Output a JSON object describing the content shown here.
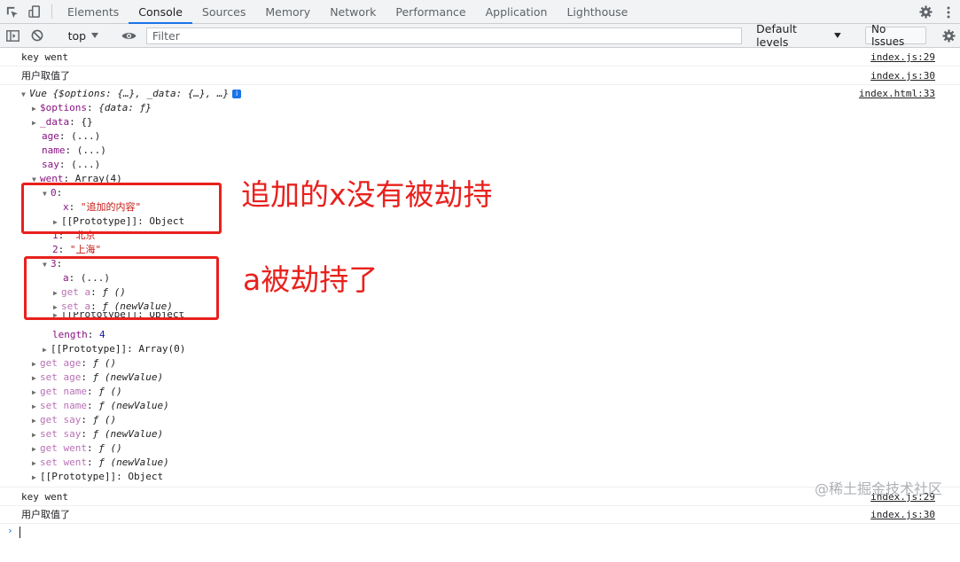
{
  "tabs": [
    "Elements",
    "Console",
    "Sources",
    "Memory",
    "Network",
    "Performance",
    "Application",
    "Lighthouse"
  ],
  "active_tab": "Console",
  "toolbar": {
    "context": "top",
    "filter_placeholder": "Filter",
    "levels": "Default levels",
    "issues": "No Issues"
  },
  "messages": [
    {
      "text": "key went",
      "source": "index.js:29"
    },
    {
      "text": "用户取值了",
      "source": "index.js:30"
    },
    {
      "text": "key went",
      "source": "index.js:29"
    },
    {
      "text": "用户取值了",
      "source": "index.js:30"
    }
  ],
  "vue_object": {
    "header": "Vue {$options: {…}, _data: {…}, …}",
    "source": "index.html:33",
    "options_key": "$options",
    "options_val": "{data: ƒ}",
    "data_key": "_data",
    "data_val": "{}",
    "age_key": "age",
    "name_key": "name",
    "say_key": "say",
    "lazy": "(...)",
    "went_key": "went",
    "went_val": "Array(4)",
    "item0_key": "0",
    "x_key": "x",
    "x_val": "\"追加的内容\"",
    "proto_key": "[[Prototype]]",
    "proto_object": "Object",
    "item1_key": "1",
    "item1_val": "\"北京\"",
    "item2_key": "2",
    "item2_val": "\"上海\"",
    "item3_key": "3",
    "a_key": "a",
    "get_a": "get a",
    "set_a": "set a",
    "fn_empty": "ƒ ()",
    "fn_param": "ƒ (newValue)",
    "length_key": "length",
    "length_val": "4",
    "proto_array": "Array(0)",
    "get_age": "get age",
    "set_age": "set age",
    "get_name": "get name",
    "set_name": "set name",
    "get_say": "get say",
    "set_say": "set say",
    "get_went": "get went",
    "set_went": "set went"
  },
  "annotations": {
    "note1": "追加的x没有被劫持",
    "note2": "a被劫持了",
    "color": "#e8211d"
  },
  "watermark": "@稀土掘金技术社区"
}
